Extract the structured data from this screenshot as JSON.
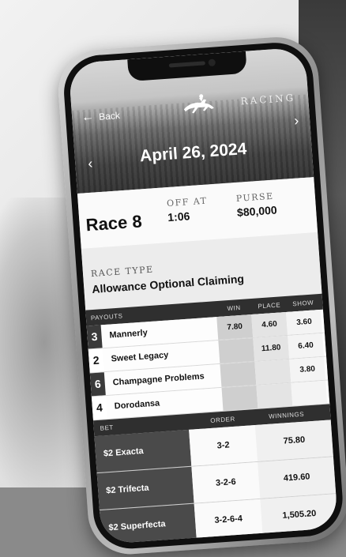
{
  "header": {
    "back_label": "Back",
    "brand": "RACING",
    "date": "April 26, 2024",
    "prev_icon": "chevron-left-icon",
    "next_icon": "chevron-right-icon"
  },
  "race": {
    "title": "Race 8",
    "off_label": "OFF AT",
    "off_value": "1:06",
    "purse_label": "PURSE",
    "purse_value": "$80,000"
  },
  "race_type": {
    "label": "RACE TYPE",
    "value": "Allowance Optional Claiming"
  },
  "payouts": {
    "header_label": "PAYOUTS",
    "col_win": "WIN",
    "col_place": "PLACE",
    "col_show": "SHOW",
    "rows": [
      {
        "num": "3",
        "name": "Mannerly",
        "win": "7.80",
        "place": "4.60",
        "show": "3.60"
      },
      {
        "num": "2",
        "name": "Sweet Legacy",
        "win": "",
        "place": "11.80",
        "show": "6.40"
      },
      {
        "num": "6",
        "name": "Champagne Problems",
        "win": "",
        "place": "",
        "show": "3.80"
      },
      {
        "num": "4",
        "name": "Dorodansa",
        "win": "",
        "place": "",
        "show": ""
      }
    ]
  },
  "bets": {
    "col_bet": "BET",
    "col_order": "ORDER",
    "col_winnings": "WINNINGS",
    "rows": [
      {
        "name": "$2 Exacta",
        "order": "3-2",
        "winnings": "75.80"
      },
      {
        "name": "$2 Trifecta",
        "order": "3-2-6",
        "winnings": "419.60"
      },
      {
        "name": "$2 Superfecta",
        "order": "3-2-6-4",
        "winnings": "1,505.20"
      }
    ]
  }
}
